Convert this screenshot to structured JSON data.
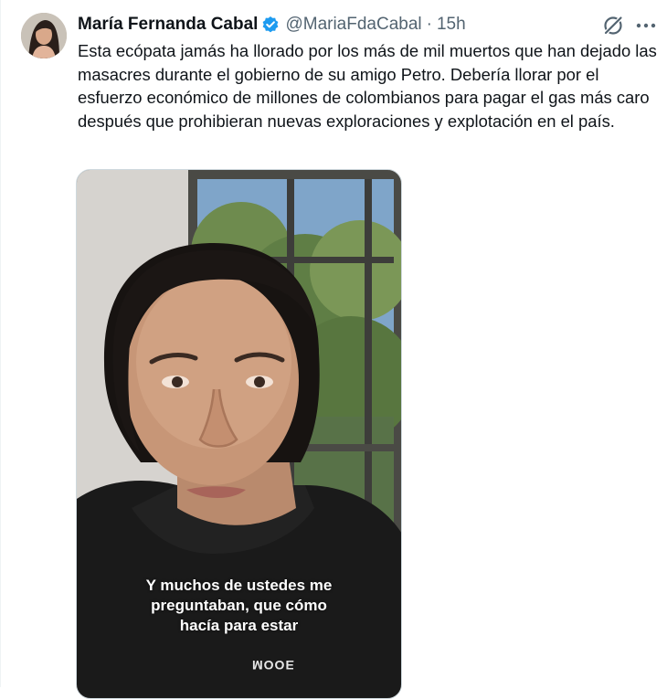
{
  "tweet": {
    "author_name": "María Fernanda Cabal",
    "handle": "@MariaFdaCabal",
    "separator": "·",
    "time": "15h",
    "text": "Esta ecópata jamás ha llorado por los más de mil muertos que han dejado las masacres durante el gobierno de su amigo Petro. Debería llorar por el esfuerzo económico de millones de colombianos para pagar el gas más caro después que prohibieran nuevas exploraciones y explotación en el país."
  },
  "media": {
    "caption_lines": [
      "Y muchos de ustedes me",
      "preguntaban, que cómo",
      "hacía para estar"
    ],
    "hoodie_text": "MOOE"
  },
  "icons": {
    "verified": "verified-badge-icon",
    "grok": "grok-icon",
    "more": "more-icon"
  },
  "colors": {
    "verified": "#1d9bf0",
    "secondary_text": "#536471",
    "primary_text": "#0f1419"
  }
}
